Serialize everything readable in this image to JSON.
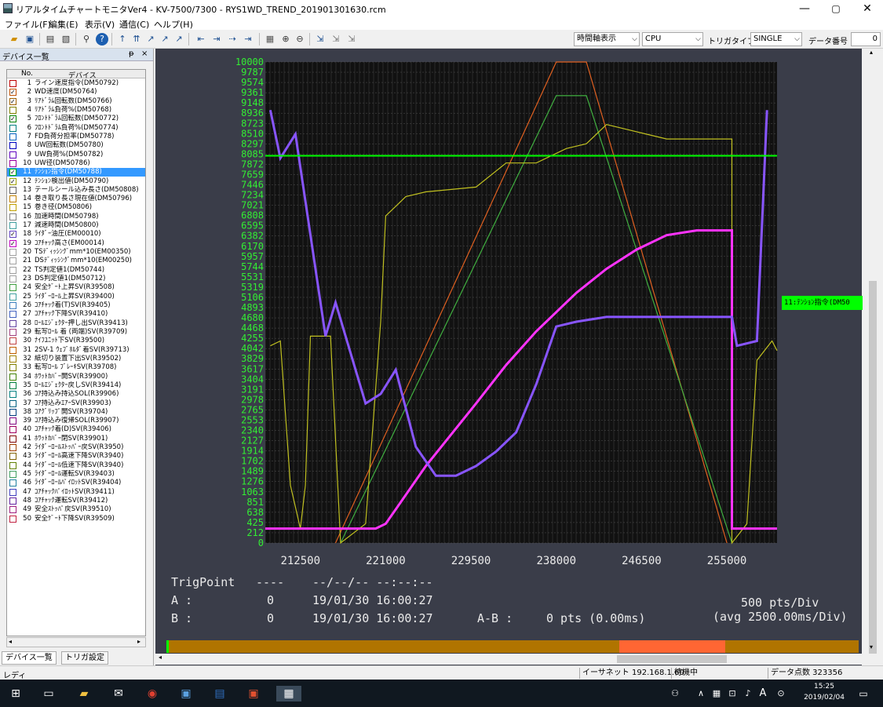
{
  "window": {
    "title": "リアルタイムチャートモニタVer4 - KV-7500/7300 - RYS1WD_TREND_20190130163​0.rcm",
    "min": "—",
    "max": "▢",
    "close": "✕"
  },
  "menu": [
    "ファイル(F)",
    "編集(E)",
    "表示(V)",
    "通信(C)",
    "ヘルプ(H)"
  ],
  "toolbar": {
    "time_axis": "時間軸表示",
    "cpu": "CPU",
    "trigger_type_label": "トリガタイプ",
    "trigger_type": "SINGLE",
    "data_number_label": "データ番号",
    "data_number": "0"
  },
  "sidebar": {
    "title": "デバイス一覧",
    "pin": "ᵽ",
    "close": "×",
    "col_no": "No.",
    "col_device": "デバイス",
    "tab1": "デバイス一覧",
    "tab2": "トリガ設定",
    "rows": [
      {
        "n": "1",
        "name": "ライン速度指令(DM50792)",
        "c": "#c00000",
        "chk": false
      },
      {
        "n": "2",
        "name": "WD速度(DM50764)",
        "c": "#c05000",
        "chk": true
      },
      {
        "n": "3",
        "name": "ﾘｱﾄﾞﾗﾑ回転数(DM50766)",
        "c": "#a06000",
        "chk": true
      },
      {
        "n": "4",
        "name": "ﾘｱﾄﾞﾗﾑ負荷%(DM50768)",
        "c": "#808000",
        "chk": false
      },
      {
        "n": "5",
        "name": "ﾌﾛﾝﾄﾄﾞﾗﾑ回転数(DM50772)",
        "c": "#008000",
        "chk": true
      },
      {
        "n": "6",
        "name": "ﾌﾛﾝﾄﾄﾞﾗﾑ負荷%(DM50774)",
        "c": "#008080",
        "chk": false
      },
      {
        "n": "7",
        "name": "FD負荷分担率(DM50778)",
        "c": "#0060c0",
        "chk": false
      },
      {
        "n": "8",
        "name": "UW回転数(DM50780)",
        "c": "#0000c0",
        "chk": false
      },
      {
        "n": "9",
        "name": "UW負荷%(DM50782)",
        "c": "#6000c0",
        "chk": false
      },
      {
        "n": "10",
        "name": "UW径(DM50786)",
        "c": "#a000a0",
        "chk": false
      },
      {
        "n": "11",
        "name": "ﾃﾝｼｮﾝ指令(DM50788)",
        "c": "#00b000",
        "chk": true
      },
      {
        "n": "12",
        "name": "ﾃﾝｼｮﾝ検出値(DM50790)",
        "c": "#a0a000",
        "chk": true
      },
      {
        "n": "13",
        "name": "テールシール込み長さ(DM50808)",
        "c": "#606060",
        "chk": false
      },
      {
        "n": "14",
        "name": "巻き取り長さ現在値(DM50796)",
        "c": "#c08000",
        "chk": false
      },
      {
        "n": "15",
        "name": "巻き径(DM50806)",
        "c": "#c0a000",
        "chk": false
      },
      {
        "n": "16",
        "name": "加速時間(DM50798)",
        "c": "#808080",
        "chk": false
      },
      {
        "n": "17",
        "name": "減速時間(DM50800)",
        "c": "#40a0a0",
        "chk": false
      },
      {
        "n": "18",
        "name": "ﾗｲﾀﾞｰ油圧(EM00010)",
        "c": "#6040c0",
        "chk": true
      },
      {
        "n": "19",
        "name": "ｺｱﾁｬｯｸ高さ(EM00014)",
        "c": "#c000c0",
        "chk": true
      },
      {
        "n": "20",
        "name": "TSﾃﾞｨｯｼﾝｸﾞmm*10(EM00350)",
        "c": "#a0a0a0",
        "chk": false
      },
      {
        "n": "21",
        "name": "DSﾃﾞｨｯｼﾝｸﾞmm*10(EM00250)",
        "c": "#a0a0a0",
        "chk": false
      },
      {
        "n": "22",
        "name": "TS判定値1(DM50744)",
        "c": "#a0a0a0",
        "chk": false
      },
      {
        "n": "23",
        "name": "DS判定値1(DM50712)",
        "c": "#a0a0a0",
        "chk": false
      },
      {
        "n": "24",
        "name": "安全ｹﾞｰﾄ上昇SV(R39508)",
        "c": "#40a040",
        "chk": false
      },
      {
        "n": "25",
        "name": "ﾗｲﾀﾞｰﾛｰﾙ上昇SV(R39400)",
        "c": "#40a0a0",
        "chk": false
      },
      {
        "n": "26",
        "name": "ｺｱﾁｬｯｸ着(T)SV(R39405)",
        "c": "#4080c0",
        "chk": false
      },
      {
        "n": "27",
        "name": "ｺｱﾁｬｯｸ下降SV(R39410)",
        "c": "#4060c0",
        "chk": false
      },
      {
        "n": "28",
        "name": "ﾛｰﾙｴｼﾞｪｸﾀｰ押し出SV(R39413)",
        "c": "#6040a0",
        "chk": false
      },
      {
        "n": "29",
        "name": "転写ﾛｰﾙ 着 (両端)SV(R39709)",
        "c": "#a04080",
        "chk": false
      },
      {
        "n": "30",
        "name": "ﾅｲﾌﾕﾆｯﾄ下SV(R39500)",
        "c": "#c04040",
        "chk": false
      },
      {
        "n": "31",
        "name": "2SV-1 ｳｪﾌﾞﾎﾙﾀﾞ着SV(R39713)",
        "c": "#c06000",
        "chk": false
      },
      {
        "n": "32",
        "name": "紙切り装置下出SV(R39502)",
        "c": "#a08000",
        "chk": false
      },
      {
        "n": "33",
        "name": "転写ﾛｰﾙ ﾌﾞﾚｰｷSV(R39708)",
        "c": "#808000",
        "chk": false
      },
      {
        "n": "34",
        "name": "ﾎﾜｯﾄｶﾊﾞｰ開SV(R39900)",
        "c": "#408000",
        "chk": false
      },
      {
        "n": "35",
        "name": "ﾛｰﾙｴｼﾞｪｸﾀｰ戻しSV(R39414)",
        "c": "#008040",
        "chk": false
      },
      {
        "n": "36",
        "name": "ｺｱ持込み持込SOL(R39906)",
        "c": "#008080",
        "chk": false
      },
      {
        "n": "37",
        "name": "ｺｱ持込みｴｱｰSV(R39903)",
        "c": "#006080",
        "chk": false
      },
      {
        "n": "38",
        "name": "ｺｱｸﾞﾘｯﾌﾟ開SV(R39704)",
        "c": "#004080",
        "chk": false
      },
      {
        "n": "39",
        "name": "ｺｱ持込み復帰SOL(R39907)",
        "c": "#800080",
        "chk": false
      },
      {
        "n": "40",
        "name": "ｺｱﾁｬｯｸ着(D)SV(R39406)",
        "c": "#a00060",
        "chk": false
      },
      {
        "n": "41",
        "name": "ﾎﾜｯﾄｶﾊﾞｰ閉SV(R39901)",
        "c": "#800000",
        "chk": false
      },
      {
        "n": "42",
        "name": "ﾗｲﾀﾞｰﾛｰﾙｽﾄｯﾊﾟｰ戻SV(R3950)",
        "c": "#a04000",
        "chk": false
      },
      {
        "n": "43",
        "name": "ﾗｲﾀﾞｰﾛｰﾙ高速下降SV(R3940)",
        "c": "#806000",
        "chk": false
      },
      {
        "n": "44",
        "name": "ﾗｲﾀﾞｰﾛｰﾙ低速下降SV(R3940)",
        "c": "#608000",
        "chk": false
      },
      {
        "n": "45",
        "name": "ﾗｲﾀﾞｰﾛｰﾙ運転SV(R39403)",
        "c": "#40a060",
        "chk": false
      },
      {
        "n": "46",
        "name": "ﾗｲﾀﾞｰﾛｰﾙﾊﾟｲﾛｯﾄSV(R39404)",
        "c": "#2080a0",
        "chk": false
      },
      {
        "n": "47",
        "name": "ｺｱﾁｬｯｸﾊﾟｲﾛｯﾄSV(R39411)",
        "c": "#4040c0",
        "chk": false
      },
      {
        "n": "48",
        "name": "ｺｱﾁｬｯｸ運転SV(R39412)",
        "c": "#6020a0",
        "chk": false
      },
      {
        "n": "49",
        "name": "安全ｽﾄｯﾊﾟ戻SV(R39510)",
        "c": "#a02080",
        "chk": false
      },
      {
        "n": "50",
        "name": "安全ｹﾞｰﾄ下降SV(R39509)",
        "c": "#c02040",
        "chk": false
      }
    ]
  },
  "legend_tag": "11:ﾃﾝｼｮﾝ指令(DM50",
  "chart_data": {
    "type": "line",
    "y_ticks": [
      "10000",
      "9787",
      "9574",
      "9361",
      "9148",
      "8936",
      "8723",
      "8510",
      "8297",
      "8085",
      "7872",
      "7659",
      "7446",
      "7234",
      "7021",
      "6808",
      "6595",
      "6382",
      "6170",
      "5957",
      "5744",
      "5531",
      "5319",
      "5106",
      "4893",
      "4680",
      "4468",
      "4255",
      "4042",
      "3829",
      "3617",
      "3404",
      "3191",
      "2978",
      "2765",
      "2553",
      "2340",
      "2127",
      "1914",
      "1702",
      "1489",
      "1276",
      "1063",
      "851",
      "638",
      "425",
      "212",
      "0"
    ],
    "x_ticks": [
      "212500",
      "221000",
      "229500",
      "238000",
      "246500",
      "255000"
    ],
    "ylim": [
      0,
      10000
    ],
    "xlim": [
      209000,
      260000
    ],
    "grid": true,
    "series": [
      {
        "color": "#e06020",
        "points": [
          [
            216000,
            0
          ],
          [
            238000,
            10000
          ],
          [
            241000,
            10000
          ],
          [
            255000,
            0
          ]
        ]
      },
      {
        "color": "#40b040",
        "points": [
          [
            216500,
            0
          ],
          [
            238000,
            9300
          ],
          [
            241000,
            9300
          ],
          [
            255500,
            0
          ]
        ]
      },
      {
        "color": "#c0c020",
        "points": [
          [
            209500,
            4100
          ],
          [
            210500,
            4200
          ],
          [
            211500,
            1200
          ],
          [
            212500,
            300
          ],
          [
            213000,
            1200
          ],
          [
            213500,
            4300
          ],
          [
            215500,
            4300
          ],
          [
            216500,
            0
          ],
          [
            219000,
            400
          ],
          [
            220500,
            4600
          ],
          [
            221000,
            6800
          ],
          [
            222000,
            7000
          ],
          [
            223000,
            7200
          ],
          [
            225000,
            7300
          ],
          [
            230000,
            7400
          ],
          [
            233000,
            7900
          ],
          [
            236000,
            7900
          ],
          [
            239000,
            8200
          ],
          [
            241000,
            8300
          ],
          [
            243000,
            8700
          ],
          [
            245000,
            8600
          ],
          [
            247000,
            8500
          ],
          [
            249000,
            8400
          ],
          [
            255500,
            8400
          ],
          [
            255500,
            0
          ],
          [
            257000,
            400
          ],
          [
            258000,
            3800
          ],
          [
            259500,
            4200
          ],
          [
            260000,
            4000
          ]
        ]
      },
      {
        "color": "#ff33ff",
        "points": [
          [
            209000,
            300
          ],
          [
            220000,
            300
          ],
          [
            221000,
            400
          ],
          [
            223000,
            1000
          ],
          [
            225000,
            1600
          ],
          [
            230000,
            2900
          ],
          [
            233000,
            3700
          ],
          [
            236000,
            4400
          ],
          [
            240000,
            5200
          ],
          [
            243000,
            5700
          ],
          [
            246000,
            6100
          ],
          [
            249000,
            6400
          ],
          [
            252000,
            6500
          ],
          [
            255500,
            6500
          ],
          [
            255500,
            300
          ],
          [
            260000,
            300
          ]
        ]
      },
      {
        "color": "#8855ff",
        "points": [
          [
            209500,
            9000
          ],
          [
            210500,
            8000
          ],
          [
            212000,
            8500
          ],
          [
            215000,
            4300
          ],
          [
            216000,
            5000
          ],
          [
            219000,
            2900
          ],
          [
            220500,
            3100
          ],
          [
            222000,
            3600
          ],
          [
            224000,
            2000
          ],
          [
            226000,
            1400
          ],
          [
            228000,
            1400
          ],
          [
            230000,
            1600
          ],
          [
            232000,
            1900
          ],
          [
            234000,
            2300
          ],
          [
            236000,
            3300
          ],
          [
            238000,
            4500
          ],
          [
            240000,
            4600
          ],
          [
            243000,
            4700
          ],
          [
            246000,
            4700
          ],
          [
            255500,
            4700
          ],
          [
            256000,
            4100
          ],
          [
            258000,
            4200
          ],
          [
            259000,
            9000
          ]
        ]
      }
    ],
    "hline": {
      "value": 8050,
      "color": "#00ff00"
    }
  },
  "info": {
    "trig_label": "TrigPoint",
    "trig_val": "----",
    "trig_date": "--/--/-- --:--:--",
    "a_label": "A :",
    "a_val": "0",
    "a_date": "19/01/30 16:00:27",
    "b_label": "B :",
    "b_val": "0",
    "b_date": "19/01/30 16:00:27",
    "ab_label": "A-B :",
    "ab_val": "0 pts (0.00ms)",
    "pts_div": "500 pts/Div",
    "avg_div": "(avg 2500.00ms/Div)"
  },
  "status": {
    "ready": "レディ",
    "ethernet": "イーサネット 192.168.1.60",
    "state": "待機中",
    "points": "データ点数 323356"
  },
  "taskbar": {
    "time": "15:25",
    "date": "2019/02/04",
    "ime": "A"
  }
}
